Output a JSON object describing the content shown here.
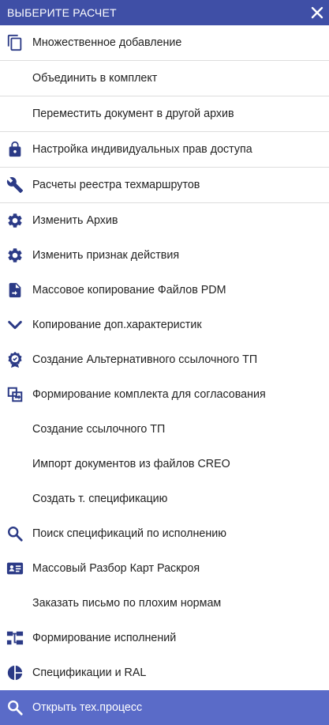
{
  "header": {
    "title": "ВЫБЕРИТЕ РАСЧЕТ",
    "close_icon": "close-icon"
  },
  "colors": {
    "header_bg": "#3f4fa6",
    "selected_bg": "#5a6bc8",
    "icon": "#2b3a86"
  },
  "items": [
    {
      "label": "Множественное добавление",
      "icon": "copy-icon"
    },
    {
      "label": "Объединить в комплект",
      "icon": ""
    },
    {
      "label": "Переместить документ в другой архив",
      "icon": ""
    },
    {
      "label": "Настройка индивидуальных прав доступа",
      "icon": "lock-icon"
    },
    {
      "label": "Расчеты реестра техмаршрутов",
      "icon": "wrench-icon"
    },
    {
      "label": "Изменить Архив",
      "icon": "gear-icon"
    },
    {
      "label": "Изменить признак действия",
      "icon": "gear-icon"
    },
    {
      "label": "Массовое копирование Файлов PDM",
      "icon": "file-move-icon"
    },
    {
      "label": "Копирование доп.характеристик",
      "icon": "chevron-down-icon"
    },
    {
      "label": "Создание Альтернативного ссылочного ТП",
      "icon": "badge-check-icon"
    },
    {
      "label": "Формирование комплекта для согласования",
      "icon": "bundle-icon"
    },
    {
      "label": "Создание ссылочного ТП",
      "icon": ""
    },
    {
      "label": "Импорт документов из файлов CREO",
      "icon": ""
    },
    {
      "label": "Создать т. спецификацию",
      "icon": ""
    },
    {
      "label": "Поиск спецификаций по исполнению",
      "icon": "search-icon"
    },
    {
      "label": "Массовый Разбор Карт Раскроя",
      "icon": "id-card-icon"
    },
    {
      "label": "Заказать письмо по плохим нормам",
      "icon": ""
    },
    {
      "label": "Формирование исполнений",
      "icon": "hierarchy-icon"
    },
    {
      "label": "Спецификации и RAL",
      "icon": "pie-icon"
    },
    {
      "label": "Открыть тех.процесс",
      "icon": "search-icon"
    }
  ]
}
